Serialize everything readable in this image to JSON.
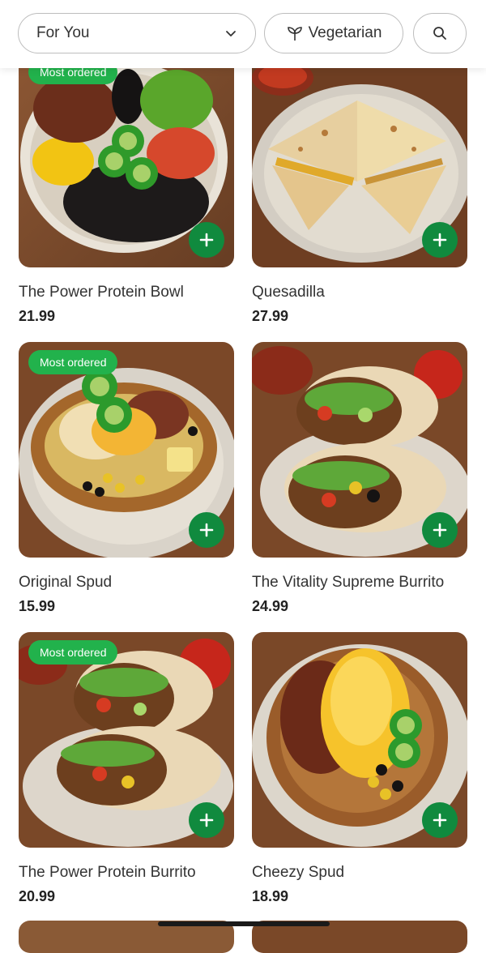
{
  "filters": {
    "sort_value": "For You",
    "vegetarian_label": "Vegetarian"
  },
  "colors": {
    "accent_green": "#108a3e",
    "badge_green": "#22b24c"
  },
  "badge_label": "Most ordered",
  "products": [
    {
      "name": "The Power Protein Bowl",
      "price": "21.99",
      "badge": "Most ordered",
      "image": "burrito-bowl"
    },
    {
      "name": "Quesadilla",
      "price": "27.99",
      "badge": "",
      "image": "quesadilla"
    },
    {
      "name": "Original Spud",
      "price": "15.99",
      "badge": "Most ordered",
      "image": "loaded-potato"
    },
    {
      "name": "The Vitality Supreme Burrito",
      "price": "24.99",
      "badge": "",
      "image": "burrito"
    },
    {
      "name": "The Power Protein Burrito",
      "price": "20.99",
      "badge": "Most ordered",
      "image": "burrito"
    },
    {
      "name": "Cheezy Spud",
      "price": "18.99",
      "badge": "",
      "image": "cheese-potato"
    }
  ],
  "icons": {
    "dropdown": "chevron-down-icon",
    "vegetarian": "leaf-icon",
    "search": "search-icon",
    "add": "plus-icon"
  }
}
